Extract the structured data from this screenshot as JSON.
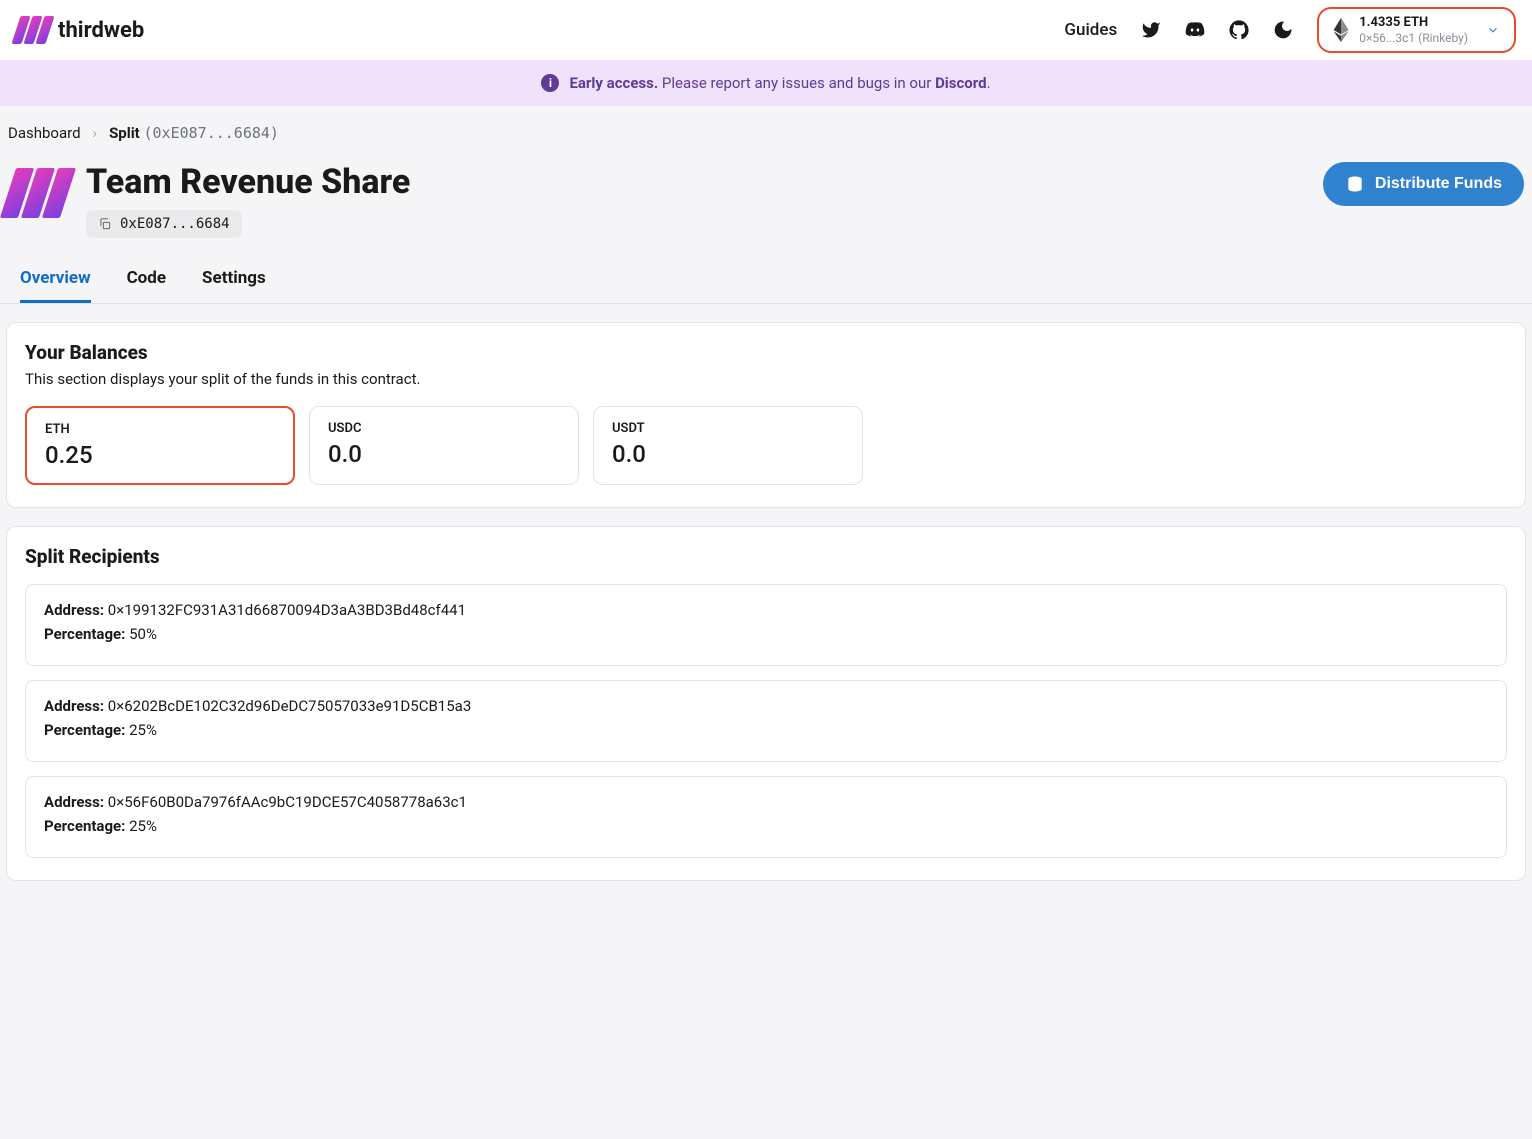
{
  "header": {
    "brand": "thirdweb",
    "guides": "Guides",
    "wallet": {
      "balance": "1.4335 ETH",
      "address_network": "0×56...3c1 (Rinkeby)"
    }
  },
  "banner": {
    "strong": "Early access.",
    "text": " Please report any issues and bugs in our ",
    "link": "Discord",
    "tail": "."
  },
  "breadcrumb": {
    "dashboard": "Dashboard",
    "current": "Split",
    "addr": "(0xE087...6684)"
  },
  "page": {
    "title": "Team Revenue Share",
    "contract_addr": "0xE087...6684",
    "distribute_btn": "Distribute Funds"
  },
  "tabs": {
    "overview": "Overview",
    "code": "Code",
    "settings": "Settings"
  },
  "balances": {
    "heading": "Your Balances",
    "subtitle": "This section displays your split of the funds in this contract.",
    "items": [
      {
        "symbol": "ETH",
        "value": "0.25"
      },
      {
        "symbol": "USDC",
        "value": "0.0"
      },
      {
        "symbol": "USDT",
        "value": "0.0"
      }
    ]
  },
  "recipients": {
    "heading": "Split Recipients",
    "address_label": "Address:",
    "percentage_label": "Percentage:",
    "items": [
      {
        "address": "0×199132FC931A31d66870094D3aA3BD3Bd48cf441",
        "percentage": "50%"
      },
      {
        "address": "0×6202BcDE102C32d96DeDC75057033e91D5CB15a3",
        "percentage": "25%"
      },
      {
        "address": "0×56F60B0Da7976fAAc9bC19DCE57C4058778a63c1",
        "percentage": "25%"
      }
    ]
  }
}
